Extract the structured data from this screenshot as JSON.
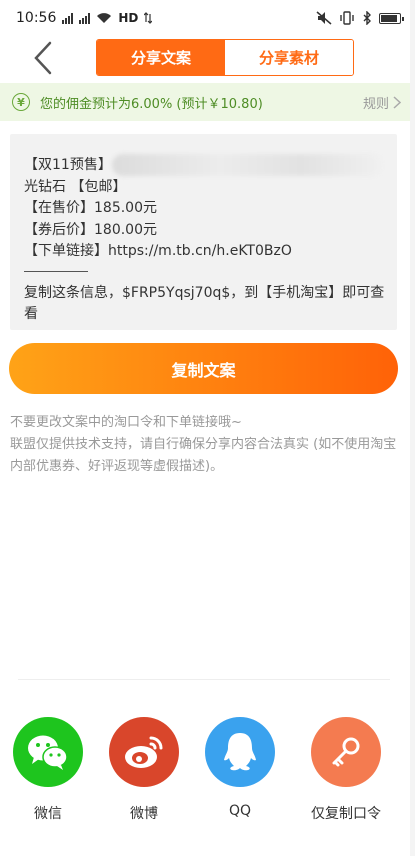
{
  "status_bar": {
    "time": "10:56",
    "network_label": "HD"
  },
  "header": {
    "tabs": [
      {
        "label": "分享文案",
        "active": true
      },
      {
        "label": "分享素材",
        "active": false
      }
    ]
  },
  "commission": {
    "icon_glyph": "¥",
    "text": "您的佣金预计为6.00% (预计￥10.80)",
    "rules_label": "规则",
    "accent_color": "#4e8d25"
  },
  "copy_text": {
    "lines": [
      "【双11预售】",
      "光钻石 【包邮】",
      "【在售价】185.00元",
      "【券后价】180.00元",
      "【下单链接】https://m.tb.cn/h.eKT0BzO"
    ],
    "instruction": "复制这条信息，$FRP5Yqsj70q$，到【手机淘宝】即可查看"
  },
  "copy_button": {
    "label": "复制文案",
    "gradient_start": "#ffa317",
    "gradient_end": "#ff6208"
  },
  "notes": {
    "line1": "不要更改文案中的淘口令和下单链接哦~",
    "line2": "联盟仅提供技术支持，请自行确保分享内容合法真实 (如不使用淘宝内部优惠券、好评返现等虚假描述)。"
  },
  "share": {
    "items": [
      {
        "label": "微信",
        "icon": "wechat-icon",
        "color": "#1ec51e"
      },
      {
        "label": "微博",
        "icon": "weibo-icon",
        "color": "#d9462b"
      },
      {
        "label": "QQ",
        "icon": "qq-icon",
        "color": "#3aa2ee"
      },
      {
        "label": "仅复制口令",
        "icon": "key-icon",
        "color": "#f47b50"
      }
    ]
  }
}
